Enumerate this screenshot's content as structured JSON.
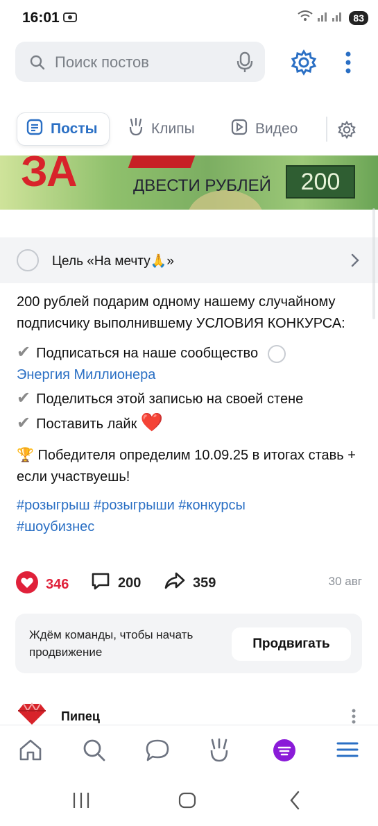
{
  "status_bar": {
    "time": "16:01",
    "battery": "83"
  },
  "search": {
    "placeholder": "Поиск постов"
  },
  "tabs": [
    {
      "label": "Посты",
      "active": true
    },
    {
      "label": "Клипы",
      "active": false
    },
    {
      "label": "Видео",
      "active": false
    }
  ],
  "banner": {
    "fragment": "ЗА",
    "caption": "ДВЕСТИ РУБЛЕЙ",
    "value": "200"
  },
  "goal": {
    "label": "Цель «На мечту🙏»"
  },
  "post": {
    "intro": "200 рублей подарим одному нашему случайному подписчику выполнившему УСЛОВИЯ КОНКУРСА:",
    "check_mark": "✔",
    "cond1": "Подписаться на наше сообщество",
    "cond1_link": "Энергия Миллионера",
    "cond2": "Поделиться этой записью на своей стене",
    "cond3": "Поставить лайк",
    "heart": "❤️",
    "trophy": "🏆",
    "winner": "Победителя определим 10.09.25 в итогах ставь + если участвуешь!",
    "hashtags_line1": "#розыгрыш #розыгрыши #конкурсы",
    "hashtags_line2": "#шоубизнес"
  },
  "actions": {
    "likes": "346",
    "comments": "200",
    "shares": "359",
    "date": "30 авг"
  },
  "promo": {
    "text": "Ждём команды, чтобы начать продвижение",
    "button": "Продвигать"
  },
  "next_post": {
    "author": "Пипец"
  },
  "colors": {
    "accent": "#2a6fc4",
    "like": "#e0213a",
    "market": "#8a1bd8"
  }
}
